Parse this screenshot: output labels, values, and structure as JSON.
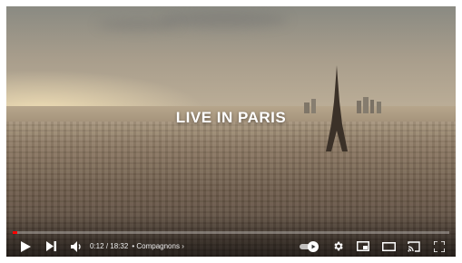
{
  "video": {
    "overlay_title": "LIVE IN PARIS"
  },
  "controls": {
    "current_time": "0:12",
    "separator": "/",
    "duration": "18:32",
    "chapter_dot": "•",
    "chapter_label": "Compagnons",
    "chapter_chevron": "›",
    "progress_fraction": 0.011,
    "progress_color": "#ff0000"
  }
}
